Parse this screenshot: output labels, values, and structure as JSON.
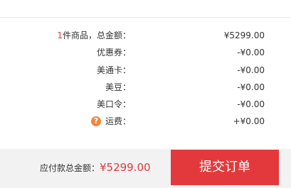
{
  "summary": {
    "goods": {
      "count": "1",
      "label": "件商品，总金额：",
      "value": "¥5299.00"
    },
    "coupon": {
      "label": "优惠券：",
      "value": "-¥0.00"
    },
    "gift_card": {
      "label": "美通卡：",
      "value": "-¥0.00"
    },
    "beans": {
      "label": "美豆：",
      "value": "-¥0.00"
    },
    "password": {
      "label": "美口令：",
      "value": "-¥0.00"
    },
    "shipping": {
      "label": "运费：",
      "value": "+¥0.00",
      "help_icon": "question-icon",
      "help_symbol": "?"
    }
  },
  "footer": {
    "total_label": "应付款总金额：",
    "total_amount": "¥5299.00",
    "submit_label": "提交订单"
  },
  "colors": {
    "accent": "#e4393c",
    "help_icon": "#f3853b",
    "footer_bg": "#f2f2f2"
  }
}
